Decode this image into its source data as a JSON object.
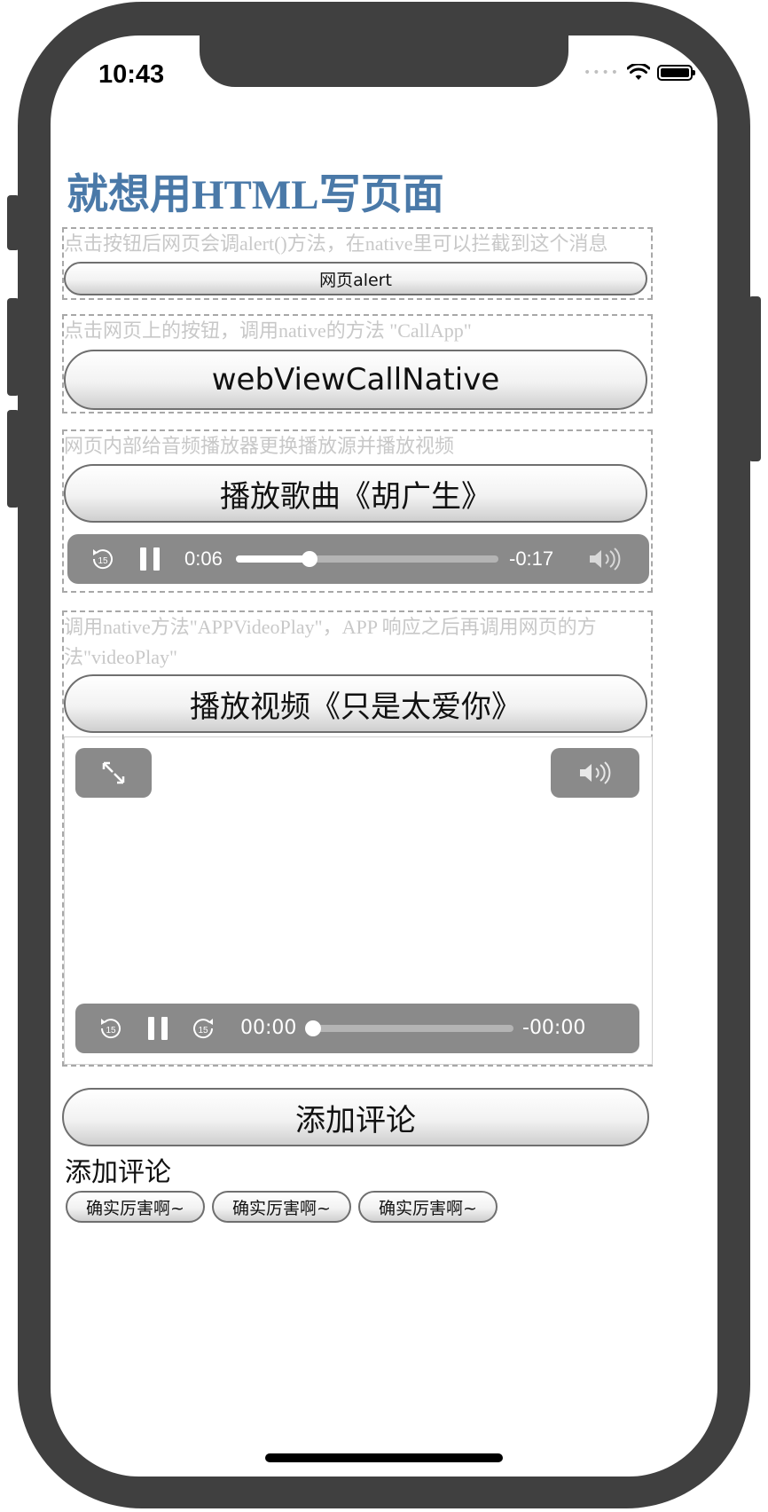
{
  "status_bar": {
    "time": "10:43",
    "signal": "••••"
  },
  "page": {
    "title": "就想用HTML写页面"
  },
  "sections": {
    "alert": {
      "hint": "点击按钮后网页会调alert()方法，在native里可以拦截到这个消息",
      "button_label": "网页alert"
    },
    "call_native": {
      "hint": "点击网页上的按钮，调用native的方法 \"CallApp\"",
      "button_label": "webViewCallNative"
    },
    "audio": {
      "hint": "网页内部给音频播放器更换播放源并播放视频",
      "button_label": "播放歌曲《胡广生》",
      "player": {
        "elapsed": "0:06",
        "remaining": "-0:17",
        "progress": 0.28
      }
    },
    "video": {
      "hint_line1": "调用native方法\"APPVideoPlay\"，APP 响应之后再调用网页的方",
      "hint_line2": "法\"videoPlay\"",
      "button_label": "播放视频《只是太爱你》",
      "player": {
        "elapsed": "00:00",
        "remaining": "-00:00",
        "progress": 0.0
      }
    }
  },
  "comments": {
    "add_button_label": "添加评论",
    "title": "添加评论",
    "items": [
      "确实厉害啊~",
      "确实厉害啊~",
      "确实厉害啊~"
    ]
  },
  "colors": {
    "title": "#4a79a8",
    "hint": "#c8c8c8",
    "player_bg": "#8a8a8a",
    "frame": "#404040"
  },
  "icons": {
    "skip_back": "skip-back-15-icon",
    "skip_forward": "skip-forward-15-icon",
    "pause": "pause-icon",
    "volume": "volume-icon",
    "fullscreen": "fullscreen-icon"
  }
}
